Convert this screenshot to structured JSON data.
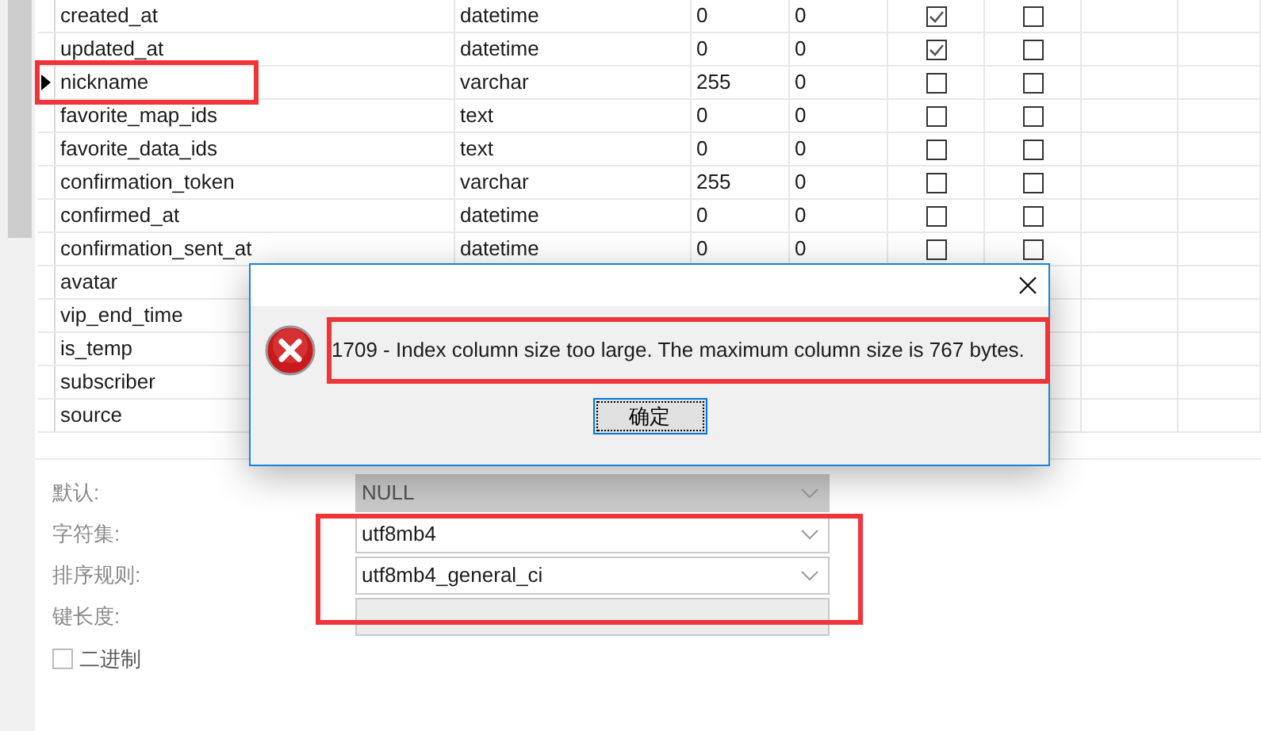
{
  "fields": [
    {
      "name": "created_at",
      "type": "datetime",
      "length": "0",
      "decimals": "0",
      "not_null": true,
      "key": false,
      "current": false
    },
    {
      "name": "updated_at",
      "type": "datetime",
      "length": "0",
      "decimals": "0",
      "not_null": true,
      "key": false,
      "current": false
    },
    {
      "name": "nickname",
      "type": "varchar",
      "length": "255",
      "decimals": "0",
      "not_null": false,
      "key": false,
      "current": true
    },
    {
      "name": "favorite_map_ids",
      "type": "text",
      "length": "0",
      "decimals": "0",
      "not_null": false,
      "key": false,
      "current": false
    },
    {
      "name": "favorite_data_ids",
      "type": "text",
      "length": "0",
      "decimals": "0",
      "not_null": false,
      "key": false,
      "current": false
    },
    {
      "name": "confirmation_token",
      "type": "varchar",
      "length": "255",
      "decimals": "0",
      "not_null": false,
      "key": false,
      "current": false
    },
    {
      "name": "confirmed_at",
      "type": "datetime",
      "length": "0",
      "decimals": "0",
      "not_null": false,
      "key": false,
      "current": false
    },
    {
      "name": "confirmation_sent_at",
      "type": "datetime",
      "length": "0",
      "decimals": "0",
      "not_null": false,
      "key": false,
      "current": false
    },
    {
      "name": "avatar",
      "current": false
    },
    {
      "name": "vip_end_time",
      "current": false
    },
    {
      "name": "is_temp",
      "current": false
    },
    {
      "name": "subscriber",
      "current": false
    },
    {
      "name": "source",
      "current": false
    }
  ],
  "properties": [
    {
      "label": "默认:",
      "value": "NULL",
      "disabled": true,
      "kind": "select"
    },
    {
      "label": "字符集:",
      "value": "utf8mb4",
      "disabled": false,
      "kind": "select"
    },
    {
      "label": "排序规则:",
      "value": "utf8mb4_general_ci",
      "disabled": false,
      "kind": "select"
    },
    {
      "label": "键长度:",
      "disabled": true,
      "kind": "text"
    }
  ],
  "binary": {
    "label": "二进制",
    "checked": false
  },
  "dialog": {
    "message": "1709 - Index column size too large. The maximum column size is 767 bytes.",
    "ok_button": "确定"
  }
}
